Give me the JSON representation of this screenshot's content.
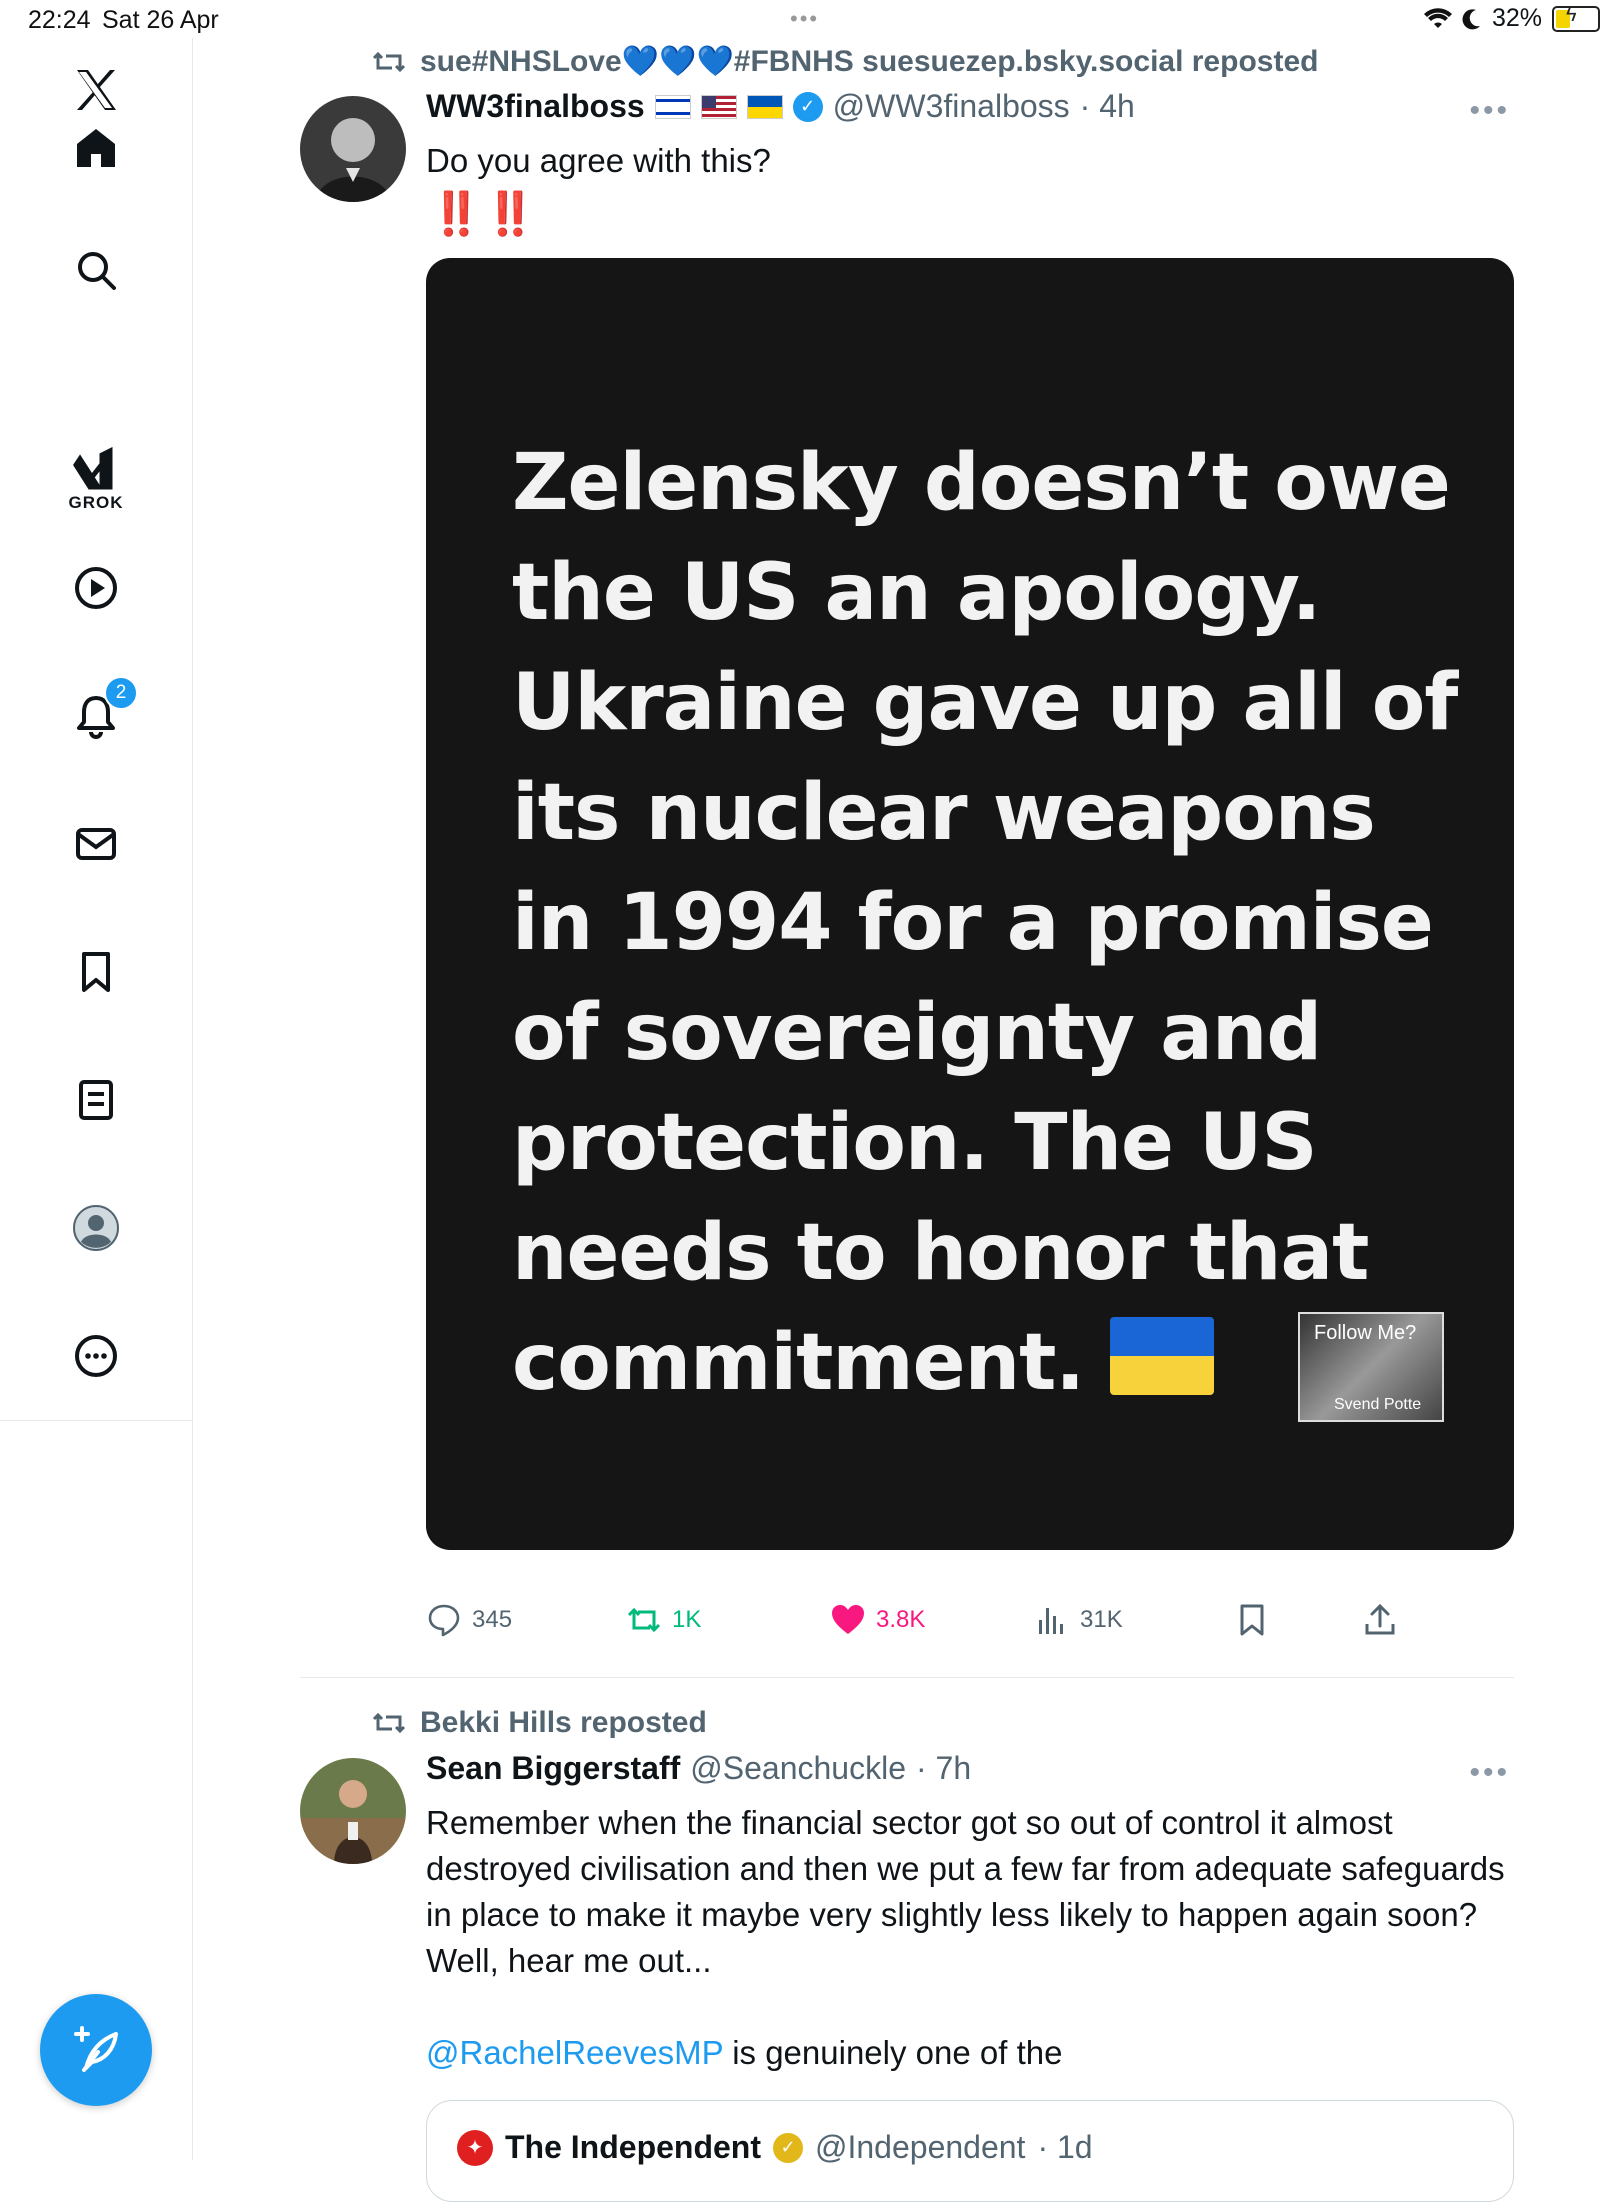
{
  "status": {
    "time": "22:24",
    "date": "Sat 26 Apr",
    "battery": "32%",
    "battery_level": 0.32
  },
  "sidebar": {
    "items": [
      {
        "name": "x-logo"
      },
      {
        "name": "home"
      },
      {
        "name": "search"
      },
      {
        "name": "grok",
        "label": "GROK"
      },
      {
        "name": "videos"
      },
      {
        "name": "notifications",
        "badge": "2"
      },
      {
        "name": "messages"
      },
      {
        "name": "bookmarks"
      },
      {
        "name": "lists"
      },
      {
        "name": "profile"
      },
      {
        "name": "more"
      }
    ]
  },
  "tweet1": {
    "repost": "sue#NHSLove💙💙💙#FBNHS suesuezep.bsky.social reposted",
    "name": "WW3finalboss",
    "handle": "@WW3finalboss",
    "time": "· 4h",
    "text": "Do you agree with this?",
    "emphasis": "‼️‼️",
    "image_text": "Zelensky doesn’t owe the US an apology. Ukraine gave up all of its nuclear weapons in 1994 for a promise of sovereignty and protection. The US needs to honor that commitment.",
    "watermark_top": "Follow Me?",
    "watermark_bottom": "Svend Potte",
    "stats": {
      "replies": "345",
      "reposts": "1K",
      "likes": "3.8K",
      "views": "31K"
    }
  },
  "tweet2": {
    "repost": "Bekki Hills reposted",
    "name": "Sean Biggerstaff",
    "handle": "@Seanchuckle",
    "time": "· 7h",
    "text": "Remember when the financial sector got so out of control it almost destroyed civilisation and then we put a few far from adequate safeguards in place to make it maybe very slightly less likely to happen again soon? Well, hear me out...",
    "mention": "@RachelReevesMP",
    "text2": " is genuinely one of the",
    "quote": {
      "name": "The Independent",
      "handle": "@Independent",
      "time": "· 1d"
    }
  }
}
